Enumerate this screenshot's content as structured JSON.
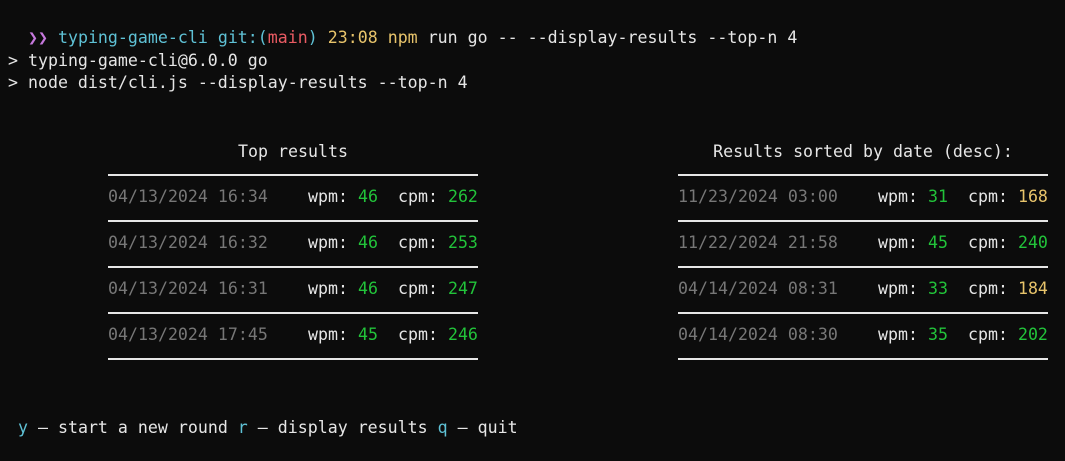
{
  "prompt": {
    "arrow": "❯❯",
    "dir": "typing-game-cli",
    "git_prefix": "git:(",
    "branch": "main",
    "git_suffix": ")",
    "time": "23:08",
    "cmd": "npm",
    "args": "run go -- --display-results --top-n 4"
  },
  "output": {
    "line1": "> typing-game-cli@6.0.0 go",
    "line2": "> node dist/cli.js --display-results --top-n 4"
  },
  "labels": {
    "wpm": "wpm: ",
    "cpm": "cpm: "
  },
  "top_results": {
    "title": "Top results",
    "rows": [
      {
        "date": "04/13/2024 16:34",
        "wpm": "46",
        "cpm": "262"
      },
      {
        "date": "04/13/2024 16:32",
        "wpm": "46",
        "cpm": "253"
      },
      {
        "date": "04/13/2024 16:31",
        "wpm": "46",
        "cpm": "247"
      },
      {
        "date": "04/13/2024 17:45",
        "wpm": "45",
        "cpm": "246"
      }
    ]
  },
  "date_results": {
    "title": "Results sorted by date (desc):",
    "rows": [
      {
        "date": "11/23/2024 03:00",
        "wpm": "31",
        "cpm": "168"
      },
      {
        "date": "11/22/2024 21:58",
        "wpm": "45",
        "cpm": "240"
      },
      {
        "date": "04/14/2024 08:31",
        "wpm": "33",
        "cpm": "184"
      },
      {
        "date": "04/14/2024 08:30",
        "wpm": "35",
        "cpm": "202"
      }
    ]
  },
  "footer": {
    "y_key": "y",
    "y_text": " – start a new round ",
    "r_key": "r",
    "r_text": " – display results ",
    "q_key": "q",
    "q_text": " – quit"
  },
  "colors": {
    "background": "#0c0c0c",
    "good": "#22c33a",
    "warn": "#e8c46b",
    "key": "#5fc2d6",
    "branch": "#ea5b63"
  }
}
